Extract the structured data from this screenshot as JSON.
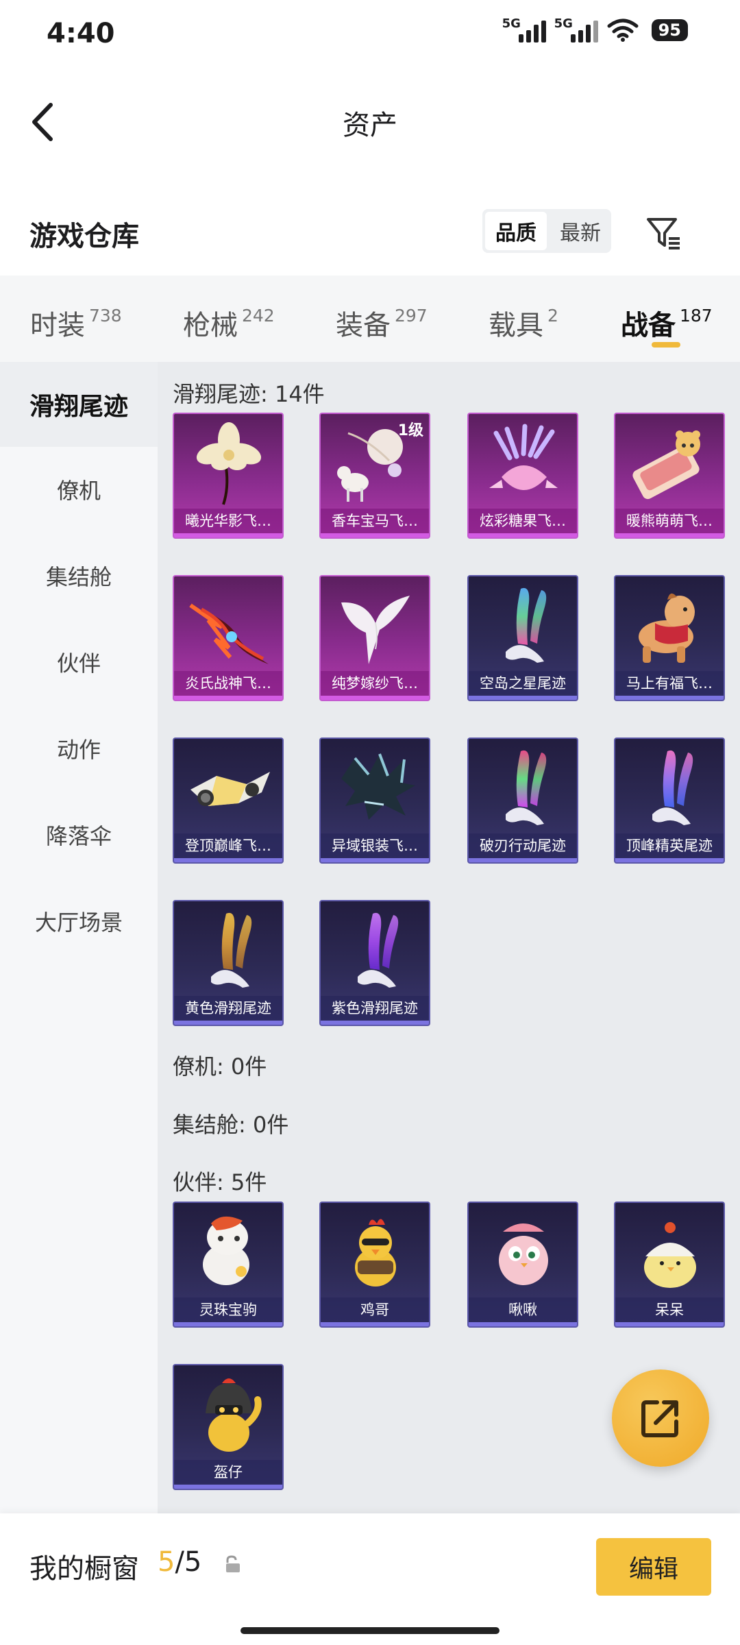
{
  "status": {
    "time": "4:40",
    "battery": "95",
    "signal1": "5G",
    "signal2": "5G"
  },
  "header": {
    "title": "资产"
  },
  "warehouse": {
    "title": "游戏仓库",
    "sort_quality": "品质",
    "sort_newest": "最新"
  },
  "tabs": [
    {
      "label": "时装",
      "count": "738"
    },
    {
      "label": "枪械",
      "count": "242"
    },
    {
      "label": "装备",
      "count": "297"
    },
    {
      "label": "载具",
      "count": "2"
    },
    {
      "label": "战备",
      "count": "187"
    }
  ],
  "sidebar": [
    "滑翔尾迹",
    "僚机",
    "集结舱",
    "伙伴",
    "动作",
    "降落伞",
    "大厅场景"
  ],
  "sections": {
    "glide": {
      "title": "滑翔尾迹: 14件",
      "items": [
        {
          "name": "曦光华影飞…",
          "art": "flower"
        },
        {
          "name": "香车宝马飞…",
          "art": "carriage",
          "badge": "1级"
        },
        {
          "name": "炫彩糖果飞…",
          "art": "candy"
        },
        {
          "name": "暖熊萌萌飞…",
          "art": "bear-bed"
        },
        {
          "name": "炎氏战神飞…",
          "art": "flame-wings"
        },
        {
          "name": "纯梦嫁纱飞…",
          "art": "veil"
        },
        {
          "name": "空岛之星尾迹",
          "art": "trail-rainbow"
        },
        {
          "name": "马上有福飞…",
          "art": "horse"
        },
        {
          "name": "登顶巅峰飞…",
          "art": "jet"
        },
        {
          "name": "异域银装飞…",
          "art": "silver-wings"
        },
        {
          "name": "破刃行动尾迹",
          "art": "trail-neon"
        },
        {
          "name": "顶峰精英尾迹",
          "art": "trail-blue"
        },
        {
          "name": "黄色滑翔尾迹",
          "art": "trail-yellow"
        },
        {
          "name": "紫色滑翔尾迹",
          "art": "trail-purple"
        }
      ]
    },
    "wingman": {
      "title": "僚机: 0件"
    },
    "capsule": {
      "title": "集结舱: 0件"
    },
    "partner": {
      "title": "伙伴: 5件",
      "items": [
        {
          "name": "灵珠宝驹",
          "art": "pet-horse"
        },
        {
          "name": "鸡哥",
          "art": "pet-chicken"
        },
        {
          "name": "啾啾",
          "art": "pet-bird"
        },
        {
          "name": "呆呆",
          "art": "pet-chick"
        },
        {
          "name": "盔仔",
          "art": "pet-helmet"
        }
      ]
    }
  },
  "bottom": {
    "showcase_label": "我的橱窗",
    "count_current": "5",
    "count_total": "/5",
    "edit_label": "编辑"
  },
  "colors": {
    "accent": "#f0b93a",
    "purple_card": "#8a2c8e",
    "blue_card": "#2d2a55"
  }
}
